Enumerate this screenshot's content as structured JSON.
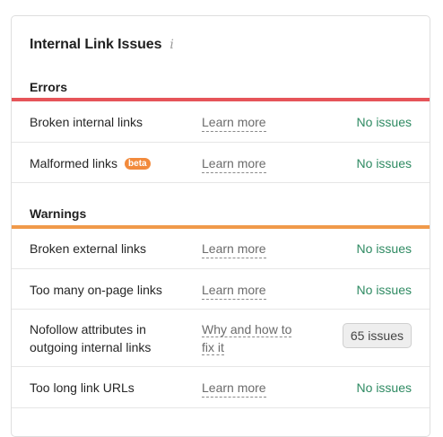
{
  "card": {
    "title": "Internal Link Issues",
    "info_icon": "i"
  },
  "colors": {
    "errors_bar": "#e65459",
    "warnings_bar": "#f09a4a",
    "ok_text": "#2e8a62",
    "beta_badge": "#f28a3c"
  },
  "sections": {
    "errors": {
      "title": "Errors",
      "rows": [
        {
          "name": "Broken internal links",
          "link": "Learn more",
          "status": "No issues"
        },
        {
          "name": "Malformed links",
          "badge": "beta",
          "link": "Learn more",
          "status": "No issues"
        }
      ]
    },
    "warnings": {
      "title": "Warnings",
      "rows": [
        {
          "name": "Broken external links",
          "link": "Learn more",
          "status": "No issues"
        },
        {
          "name": "Too many on-page links",
          "link": "Learn more",
          "status": "No issues"
        },
        {
          "name_line1": "Nofollow attributes in",
          "name_line2": "outgoing internal links",
          "link_line1": "Why and how to",
          "link_line2": "fix it",
          "status": "65 issues"
        },
        {
          "name": "Too long link URLs",
          "link": "Learn more",
          "status": "No issues"
        }
      ]
    }
  }
}
